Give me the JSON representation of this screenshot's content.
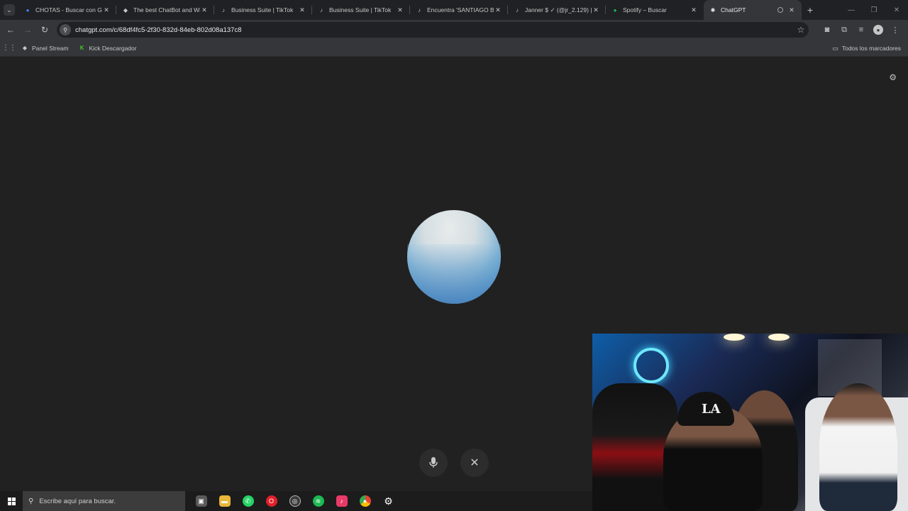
{
  "browser": {
    "tabs": [
      {
        "title": "CHOTAS - Buscar con Google",
        "favicon": "google-icon",
        "color": "#4285f4"
      },
      {
        "title": "The best ChatBot and Wi",
        "favicon": "chatbot-icon",
        "color": "#c4c7c5"
      },
      {
        "title": "Business Suite | TikTok",
        "favicon": "tiktok-icon",
        "color": "#ffffff"
      },
      {
        "title": "Business Suite | TikTok",
        "favicon": "tiktok-icon",
        "color": "#ffffff"
      },
      {
        "title": "Encuentra 'SANTIAGO BC",
        "favicon": "tiktok-icon",
        "color": "#ffffff"
      },
      {
        "title": "Janner $ ✓ (@jr_2.129) |",
        "favicon": "tiktok-icon",
        "color": "#ffffff"
      },
      {
        "title": "Spotify – Buscar",
        "favicon": "spotify-icon",
        "color": "#1db954"
      },
      {
        "title": "ChatGPT",
        "favicon": "chatgpt-icon",
        "color": "#c4c7c5",
        "active": true
      }
    ],
    "url": "chatgpt.com/c/68df4fc5-2f30-832d-84eb-802d08a137c8",
    "bookmarks": [
      {
        "label": "Panel Stream",
        "icon": "diamond-icon"
      },
      {
        "label": "Kick Descargador",
        "icon": "kick-icon"
      }
    ],
    "all_bookmarks": "Todos los marcadores"
  },
  "taskbar": {
    "search_placeholder": "Escribe aquí para buscar.",
    "apps": [
      {
        "name": "media-player-icon",
        "color": "#5a5a5a",
        "glyph": "▣"
      },
      {
        "name": "file-explorer-icon",
        "color": "#e8b73a",
        "glyph": "▬"
      },
      {
        "name": "whatsapp-icon",
        "color": "#25d366",
        "glyph": "✆"
      },
      {
        "name": "opera-icon",
        "color": "#e0202a",
        "glyph": "O"
      },
      {
        "name": "obs-icon",
        "color": "#3a3a3a",
        "glyph": "◎"
      },
      {
        "name": "spotify-icon",
        "color": "#1db954",
        "glyph": "≋"
      },
      {
        "name": "tiktok-icon",
        "color": "#e83a68",
        "glyph": "♪"
      },
      {
        "name": "chrome-icon",
        "color": "#e5473b",
        "glyph": "◉"
      },
      {
        "name": "settings-icon",
        "color": "#1c1c1c",
        "glyph": "⚙"
      }
    ]
  },
  "webcam": {
    "cap_logo": "LA"
  }
}
